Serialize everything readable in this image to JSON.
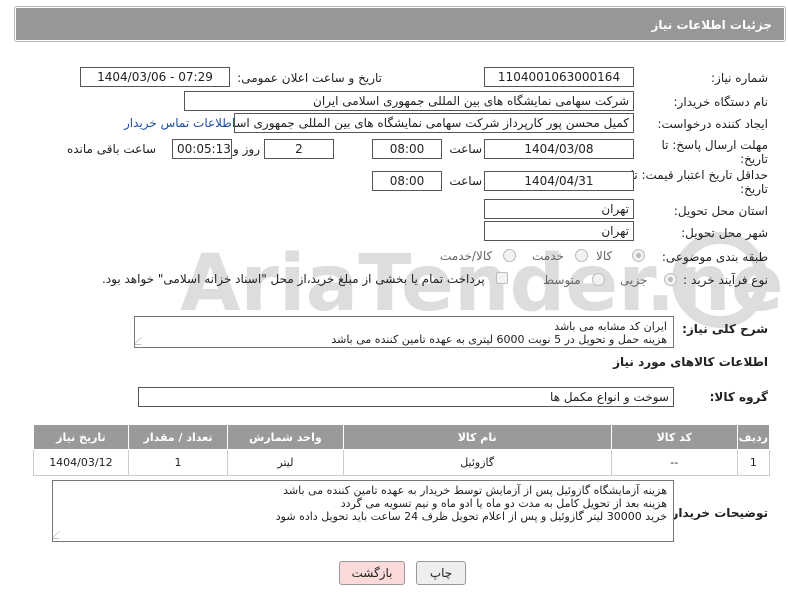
{
  "header": {
    "title": "جزئیات اطلاعات نیاز"
  },
  "fields": {
    "need_number_label": "شماره نیاز:",
    "need_number": "1104001063000164",
    "announce_label": "تاریخ و ساعت اعلان عمومی:",
    "announce_value": "1404/03/06 - 07:29",
    "buyer_org_label": "نام دستگاه خریدار:",
    "buyer_org": "شرکت سهامی نمایشگاه های بین المللی جمهوری اسلامی ایران",
    "creator_label": "ایجاد کننده درخواست:",
    "creator": "کمیل محسن پور کارپرداز شرکت سهامی نمایشگاه های بین المللی جمهوری اسلامی ایران",
    "contact_link": "اطلاعات تماس خریدار",
    "deadline_label": "مهلت ارسال پاسخ: تا تاریخ:",
    "deadline_date": "1404/03/08",
    "time_label": "ساعت",
    "deadline_time": "08:00",
    "days_value": "2",
    "days_label": "روز و",
    "remaining_time": "00:05:13",
    "remaining_label": "ساعت باقی مانده",
    "price_validity_label": "حداقل تاریخ اعتبار قیمت: تا تاریخ:",
    "price_date": "1404/04/31",
    "price_time": "08:00",
    "province_label": "استان محل تحویل:",
    "province": "تهران",
    "city_label": "شهر محل تحویل:",
    "city": "تهران",
    "category_label": "طبقه بندی موضوعی:",
    "category_options": [
      "کالا",
      "خدمت",
      "کالا/خدمت"
    ],
    "process_label": "نوع فرآیند خرید :",
    "process_options": [
      "جزیی",
      "متوسط"
    ],
    "payment_note": "پرداخت تمام یا بخشی از مبلغ خرید،از محل \"اسناد خزانه اسلامی\" خواهد بود."
  },
  "description": {
    "label": "شرح کلی نیاز:",
    "lines": [
      "ایران کد مشابه می باشد",
      "هزینه حمل و تحویل در 5 نوبت 6000 لیتری به عهده تامین کننده می باشد"
    ]
  },
  "goods_info_title": "اطلاعات کالاهای مورد نیاز",
  "goods_group": {
    "label": "گروه کالا:",
    "value": "سوخت و انواع مکمل ها"
  },
  "table": {
    "headers": [
      "ردیف",
      "کد کالا",
      "نام کالا",
      "واحد شمارش",
      "تعداد / مقدار",
      "تاریخ نیاز"
    ],
    "rows": [
      [
        "1",
        "--",
        "گازوئیل",
        "لیتر",
        "1",
        "1404/03/12"
      ]
    ]
  },
  "buyer_notes": {
    "label": "توضیحات خریدار:",
    "lines": [
      "هزینه آزمایشگاه گازوئیل پس از آزمایش توسط خریدار به عهده تامین کننده می باشد",
      "هزینه بعد از تحویل کامل به مدت دو ماه یا ادو ماه و نیم  تسویه می گردد",
      "خرید 30000 لیتر گازوئیل و پس از اعلام تحویل ظرف 24 ساعت باید تحویل داده شود"
    ]
  },
  "buttons": {
    "print": "چاپ",
    "back": "بازگشت"
  },
  "watermark": {
    "text": "AriaTender.net"
  }
}
